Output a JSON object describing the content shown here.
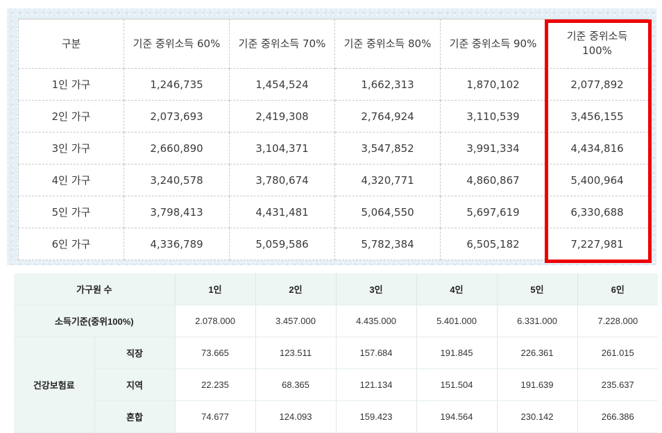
{
  "income_table": {
    "header": [
      "구분",
      "기준 중위소득 60%",
      "기준 중위소득 70%",
      "기준 중위소득 80%",
      "기준 중위소득 90%",
      "기준 중위소득 100%"
    ],
    "rows": [
      [
        "1인 가구",
        "1,246,735",
        "1,454,524",
        "1,662,313",
        "1,870,102",
        "2,077,892"
      ],
      [
        "2인 가구",
        "2,073,693",
        "2,419,308",
        "2,764,924",
        "3,110,539",
        "3,456,155"
      ],
      [
        "3인 가구",
        "2,660,890",
        "3,104,371",
        "3,547,852",
        "3,991,334",
        "4,434,816"
      ],
      [
        "4인 가구",
        "3,240,578",
        "3,780,674",
        "4,320,771",
        "4,860,867",
        "5,400,964"
      ],
      [
        "5인 가구",
        "3,798,413",
        "4,431,481",
        "5,064,550",
        "5,697,619",
        "6,330,688"
      ],
      [
        "6인 가구",
        "4,336,789",
        "5,059,586",
        "5,782,384",
        "6,505,182",
        "7,227,981"
      ]
    ],
    "highlight_color": "#ee0000"
  },
  "insurance_table": {
    "header": [
      "가구원 수",
      "1인",
      "2인",
      "3인",
      "4인",
      "5인",
      "6인"
    ],
    "income_row": {
      "label": "소득기준(중위100%)",
      "values": [
        "2.078.000",
        "3.457.000",
        "4.435.000",
        "5.401.000",
        "6.331.000",
        "7.228.000"
      ]
    },
    "group_label": "건강보험료",
    "rows": [
      {
        "label": "직장",
        "values": [
          "73.665",
          "123.511",
          "157.684",
          "191.845",
          "226.361",
          "261.015"
        ]
      },
      {
        "label": "지역",
        "values": [
          "22.235",
          "68.365",
          "121.134",
          "151.504",
          "191.639",
          "235.637"
        ]
      },
      {
        "label": "혼합",
        "values": [
          "74.677",
          "124.093",
          "159.423",
          "194.564",
          "230.142",
          "266.386"
        ]
      }
    ],
    "header_bg": "#eef6f4"
  }
}
